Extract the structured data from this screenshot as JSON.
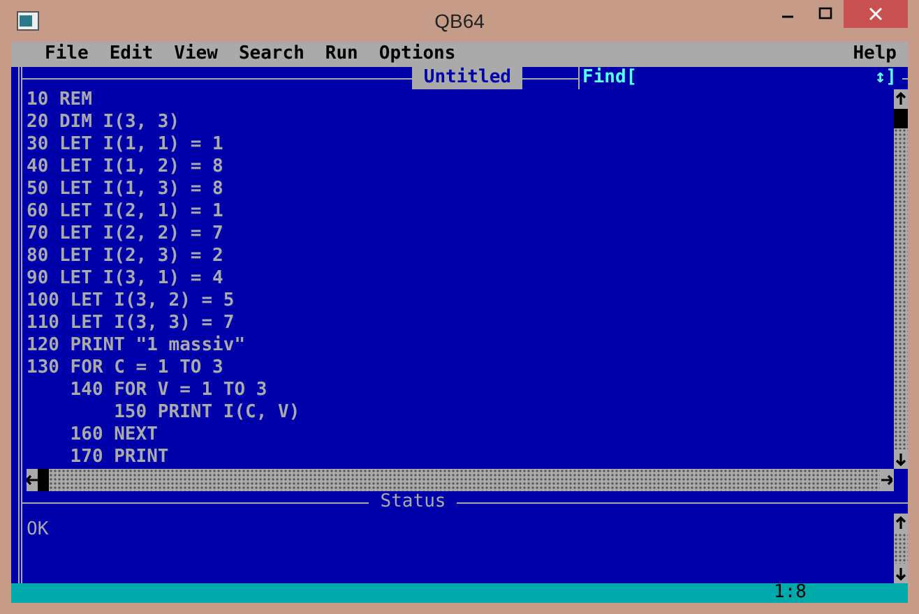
{
  "window": {
    "title": "QB64"
  },
  "menu": {
    "items": [
      "File",
      "Edit",
      "View",
      "Search",
      "Run",
      "Options"
    ],
    "help": "Help"
  },
  "editor": {
    "title": "Untitled",
    "find": {
      "label": "Find[",
      "suffix": "↕]"
    },
    "lines": [
      {
        "text": "10 REM"
      },
      {
        "text": "20 DIM I(3, 3)"
      },
      {
        "text": "30 LET I(1, 1) = 1"
      },
      {
        "text": "40 LET I(1, 2) = 8"
      },
      {
        "text": "50 LET I(1, 3) = 8"
      },
      {
        "text": "60 LET I(2, 1) = 1"
      },
      {
        "text": "70 LET I(2, 2) = 7"
      },
      {
        "text": "80 LET I(2, 3) = 2"
      },
      {
        "text": "90 LET I(3, 1) = 4"
      },
      {
        "text": "100 LET I(3, 2) = 5"
      },
      {
        "text": "110 LET I(3, 3) = 7"
      },
      {
        "text": "120 PRINT \"1 massiv\""
      },
      {
        "text": "130 FOR C = 1 TO 3",
        "children": [
          {
            "text": "140 FOR V = 1 TO 3",
            "children": [
              {
                "text": "150 PRINT I(C, V)"
              }
            ]
          },
          {
            "text": "160 NEXT"
          },
          {
            "text": "170 PRINT"
          }
        ]
      }
    ]
  },
  "status": {
    "title": "Status",
    "message": "OK"
  },
  "status_bar": {
    "position": "1:8"
  }
}
